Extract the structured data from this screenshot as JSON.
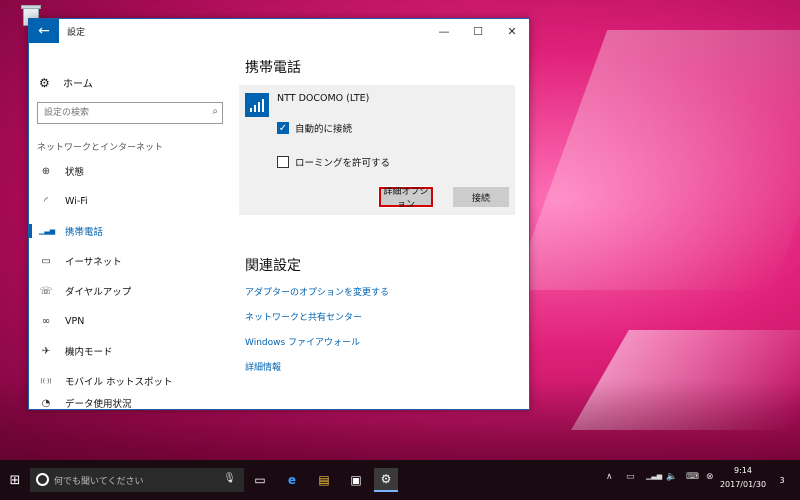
{
  "window": {
    "title": "設定",
    "back_icon": "←",
    "minimize": "—",
    "maximize": "☐",
    "close": "✕"
  },
  "sidebar": {
    "home_label": "ホーム",
    "search_placeholder": "設定の検索",
    "section_label": "ネットワークとインターネット",
    "items": [
      {
        "label": "状態",
        "icon": "globe-icon",
        "glyph": "⊕"
      },
      {
        "label": "Wi-Fi",
        "icon": "wifi-icon",
        "glyph": "◜"
      },
      {
        "label": "携帯電話",
        "icon": "cellular-icon",
        "glyph": "▁▃▅"
      },
      {
        "label": "イーサネット",
        "icon": "ethernet-icon",
        "glyph": "▭"
      },
      {
        "label": "ダイヤルアップ",
        "icon": "dialup-icon",
        "glyph": "☏"
      },
      {
        "label": "VPN",
        "icon": "vpn-icon",
        "glyph": "∞"
      },
      {
        "label": "機内モード",
        "icon": "airplane-icon",
        "glyph": "✈"
      },
      {
        "label": "モバイル ホットスポット",
        "icon": "hotspot-icon",
        "glyph": "((·))"
      },
      {
        "label": "データ使用状況",
        "icon": "data-usage-icon",
        "glyph": "◔"
      }
    ]
  },
  "main": {
    "title": "携帯電話",
    "network_name": "NTT DOCOMO (LTE)",
    "auto_connect_label": "自動的に接続",
    "auto_connect_checked": true,
    "roaming_label": "ローミングを許可する",
    "roaming_checked": false,
    "advanced_button": "詳細オプション",
    "connect_button": "接続",
    "related_title": "関連設定",
    "links": [
      "アダプターのオプションを変更する",
      "ネットワークと共有センター",
      "Windows ファイアウォール",
      "詳細情報"
    ]
  },
  "taskbar": {
    "search_placeholder": "何でも聞いてください",
    "time": "9:14",
    "date": "2017/01/30",
    "notification_count": "3"
  }
}
